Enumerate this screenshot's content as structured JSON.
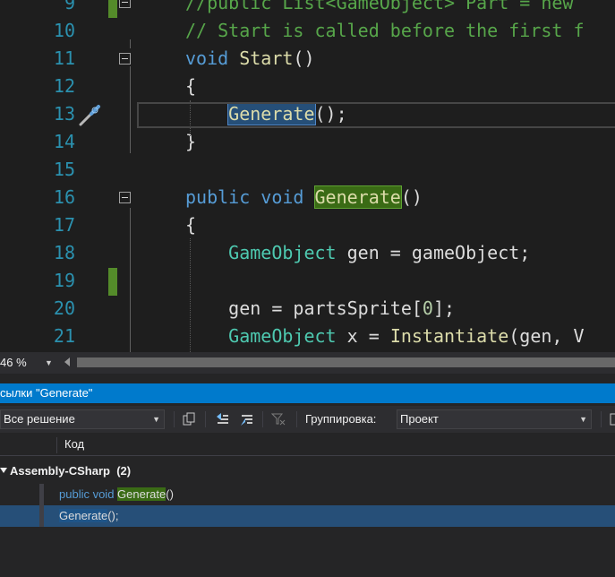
{
  "editor": {
    "lines": [
      {
        "num": "9",
        "segments": [
          {
            "t": "//public List<GameObject> Part = new",
            "c": "cm"
          }
        ]
      },
      {
        "num": "10",
        "segments": [
          {
            "t": "// Start is called before the first f",
            "c": "cm"
          }
        ]
      },
      {
        "num": "11",
        "segments": [
          {
            "t": "void",
            "c": "kw"
          },
          {
            "t": " Start",
            "c": "fn"
          },
          {
            "t": "()",
            "c": ""
          }
        ]
      },
      {
        "num": "12",
        "segments": [
          {
            "t": "{",
            "c": ""
          }
        ]
      },
      {
        "num": "13",
        "segments": [
          {
            "t": "    ",
            "c": ""
          },
          {
            "t": "Generate",
            "c": "fn hl-ref"
          },
          {
            "t": "();",
            "c": ""
          }
        ]
      },
      {
        "num": "14",
        "segments": [
          {
            "t": "}",
            "c": ""
          }
        ]
      },
      {
        "num": "15",
        "segments": []
      },
      {
        "num": "16",
        "segments": [
          {
            "t": "public",
            "c": "kw"
          },
          {
            "t": " ",
            "c": ""
          },
          {
            "t": "void",
            "c": "kw"
          },
          {
            "t": " ",
            "c": ""
          },
          {
            "t": "Generate",
            "c": "fn hl-def"
          },
          {
            "t": "()",
            "c": ""
          }
        ]
      },
      {
        "num": "17",
        "segments": [
          {
            "t": "{",
            "c": ""
          }
        ]
      },
      {
        "num": "18",
        "segments": [
          {
            "t": "    ",
            "c": ""
          },
          {
            "t": "GameObject",
            "c": "ty"
          },
          {
            "t": " gen = gameObject;",
            "c": ""
          }
        ]
      },
      {
        "num": "19",
        "segments": []
      },
      {
        "num": "20",
        "segments": [
          {
            "t": "    gen = partsSprite[",
            "c": ""
          },
          {
            "t": "0",
            "c": "num"
          },
          {
            "t": "];",
            "c": ""
          }
        ]
      },
      {
        "num": "21",
        "segments": [
          {
            "t": "    ",
            "c": ""
          },
          {
            "t": "GameObject",
            "c": "ty"
          },
          {
            "t": " x = ",
            "c": ""
          },
          {
            "t": "Instantiate",
            "c": "fn"
          },
          {
            "t": "(gen, V",
            "c": ""
          }
        ]
      }
    ]
  },
  "zoom": {
    "value": "46 %"
  },
  "panel": {
    "title": "сылки \"Generate\"",
    "scope_dropdown": "Все решение",
    "grouping_label": "Группировка:",
    "grouping_value": "Проект",
    "column_code": "Код",
    "group": {
      "name": "Assembly-CSharp",
      "count": "(2)"
    },
    "rows": [
      {
        "kw": "public void ",
        "name": "Generate",
        "rest": "()",
        "kind": "def",
        "selected": false
      },
      {
        "kw": "",
        "name": "Generate",
        "rest": "();",
        "kind": "ref",
        "selected": true
      }
    ]
  },
  "colors": {
    "accent": "#007acc",
    "selection": "#264f78",
    "definition_highlight": "#3a6b15"
  }
}
